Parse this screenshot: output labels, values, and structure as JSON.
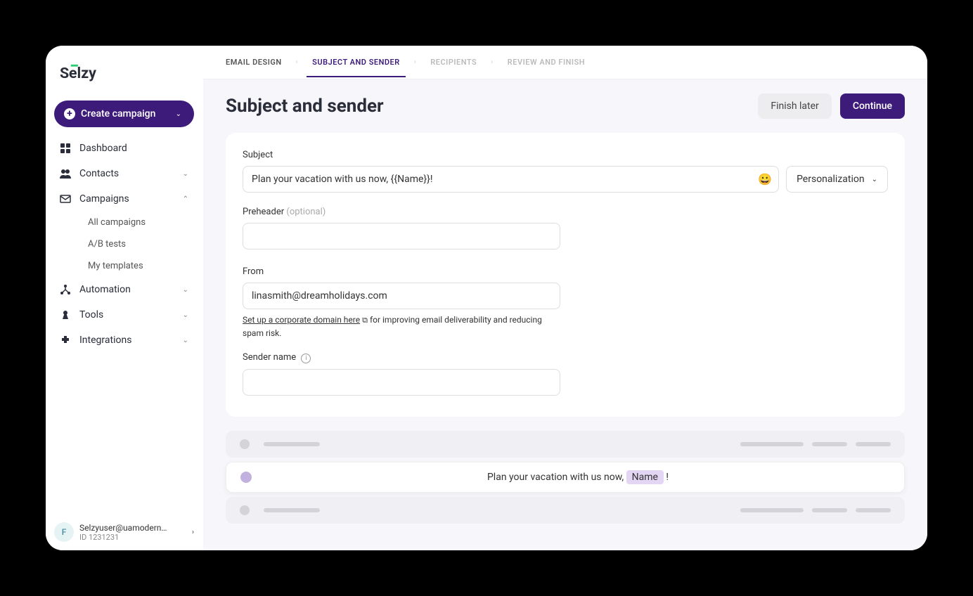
{
  "brand": "Sēlzy",
  "sidebar": {
    "create_label": "Create campaign",
    "items": [
      {
        "label": "Dashboard"
      },
      {
        "label": "Contacts"
      },
      {
        "label": "Campaigns"
      },
      {
        "label": "Automation"
      },
      {
        "label": "Tools"
      },
      {
        "label": "Integrations"
      }
    ],
    "campaigns_sub": [
      {
        "label": "All campaigns"
      },
      {
        "label": "A/B tests"
      },
      {
        "label": "My templates"
      }
    ]
  },
  "user": {
    "avatar_letter": "F",
    "email": "Selzyuser@uamodern…",
    "id_label": "ID 1231231"
  },
  "breadcrumb": {
    "step1": "EMAIL DESIGN",
    "step2": "SUBJECT AND SENDER",
    "step3": "RECIPIENTS",
    "step4": "REVIEW AND FINISH"
  },
  "page": {
    "title": "Subject and sender",
    "finish_later": "Finish later",
    "continue": "Continue"
  },
  "form": {
    "subject_label": "Subject",
    "subject_value": "Plan your vacation with us now, {{Name}}!",
    "emoji": "😀",
    "personalization_label": "Personalization",
    "preheader_label": "Preheader",
    "preheader_optional": "(optional)",
    "preheader_value": "",
    "from_label": "From",
    "from_value": "linasmith@dreamholidays.com",
    "domain_link": "Set up a corporate domain here",
    "domain_hint": " for improving email deliverability and reducing spam risk.",
    "sender_label": "Sender name",
    "sender_value": ""
  },
  "preview": {
    "text_before": "Plan your vacation with us now, ",
    "name_tag": "Name",
    "text_after": " !"
  }
}
